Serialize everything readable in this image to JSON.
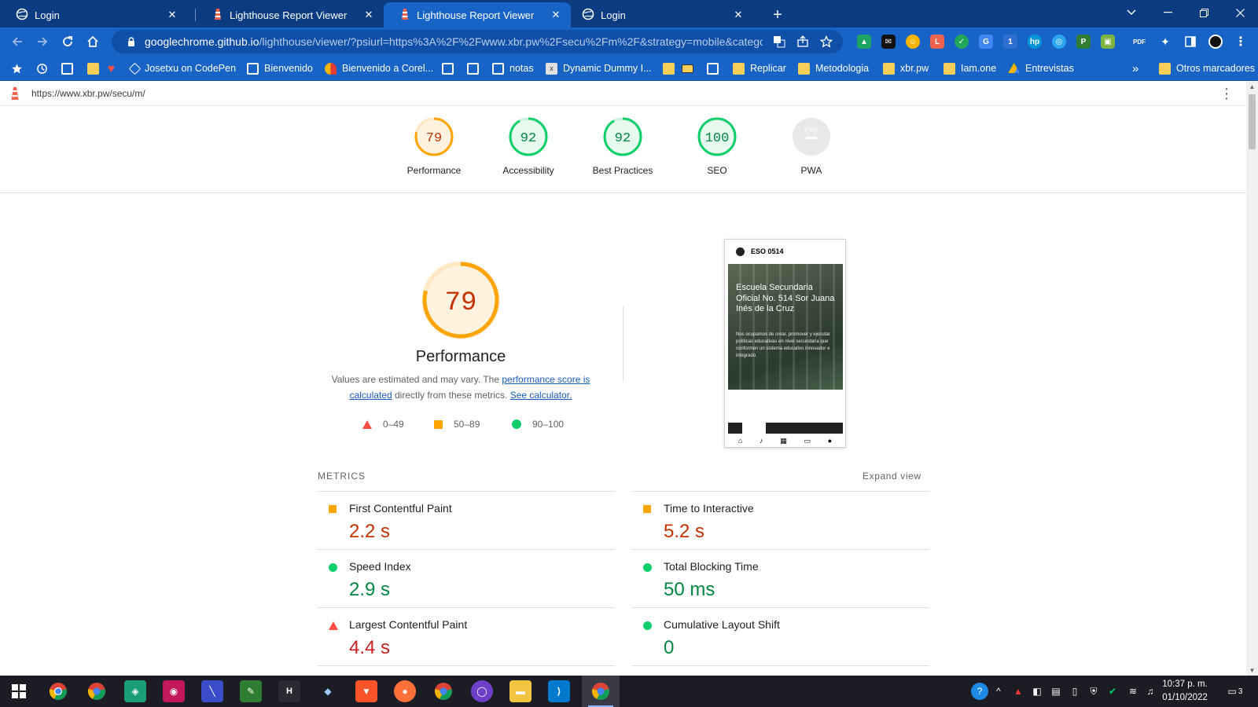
{
  "browser": {
    "tabs": [
      {
        "title": "Login",
        "icon": "globe-icon",
        "active": false
      },
      {
        "title": "Lighthouse Report Viewer",
        "icon": "lighthouse-icon",
        "active": false
      },
      {
        "title": "Lighthouse Report Viewer",
        "icon": "lighthouse-icon",
        "active": true
      },
      {
        "title": "Login",
        "icon": "globe-icon",
        "active": false
      }
    ],
    "close_glyph": "✕",
    "new_tab_glyph": "+",
    "omnibox": {
      "host": "googlechrome.github.io",
      "path": "/lighthouse/viewer/?psiurl=https%3A%2F%2Fwww.xbr.pw%2Fsecu%2Fm%2F&strategy=mobile&catego..."
    },
    "bookmarks": [
      {
        "label": "",
        "icon": "star-icon"
      },
      {
        "label": "",
        "icon": "history-icon"
      },
      {
        "label": "",
        "icon": "globe-icon"
      },
      {
        "label": "",
        "icon": "folder-icon"
      },
      {
        "label": "",
        "icon": "heart-icon"
      },
      {
        "label": "Josetxu on CodePen",
        "icon": "codepen-icon"
      },
      {
        "label": "Bienvenido",
        "icon": "globe-icon"
      },
      {
        "label": "Bienvenido a Corel...",
        "icon": "corel-icon"
      },
      {
        "label": "",
        "icon": "globe-icon"
      },
      {
        "label": "",
        "icon": "globe-icon"
      },
      {
        "label": "notas",
        "icon": "globe-icon"
      },
      {
        "label": "Dynamic Dummy I...",
        "icon": "dummy-icon"
      },
      {
        "label": "",
        "icon": "folder-icon"
      },
      {
        "label": "",
        "icon": "briefcase-icon"
      },
      {
        "label": "",
        "icon": "globe-icon"
      },
      {
        "label": "Replicar",
        "icon": "folder-icon"
      },
      {
        "label": "Metodologia",
        "icon": "folder-icon"
      },
      {
        "label": "xbr.pw",
        "icon": "folder-icon"
      },
      {
        "label": "Iam.one",
        "icon": "folder-icon"
      },
      {
        "label": "Entrevistas",
        "icon": "drive-icon"
      },
      {
        "label": "»",
        "icon": ""
      },
      {
        "label": "Otros marcadores",
        "icon": "folder-icon"
      }
    ]
  },
  "report": {
    "url": "https://www.xbr.pw/secu/m/",
    "categories": [
      {
        "label": "Performance",
        "score": "79",
        "status": "average"
      },
      {
        "label": "Accessibility",
        "score": "92",
        "status": "pass"
      },
      {
        "label": "Best Practices",
        "score": "92",
        "status": "pass"
      },
      {
        "label": "SEO",
        "score": "100",
        "status": "pass"
      },
      {
        "label": "PWA",
        "score": "PWA",
        "status": "na"
      }
    ],
    "performance": {
      "score": "79",
      "title": "Performance",
      "desc_prefix": "Values are estimated and may vary. The ",
      "desc_link1": "performance score is calculated",
      "desc_mid": " directly from these metrics. ",
      "desc_link2": "See calculator."
    },
    "legend": [
      {
        "range": "0–49",
        "status": "fail"
      },
      {
        "range": "50–89",
        "status": "average"
      },
      {
        "range": "90–100",
        "status": "pass"
      }
    ],
    "screenshot": {
      "site_name": "ESO 0514",
      "heading": "Escuela Secundaria Oficial No. 514 Sor Juana Inés de la Cruz",
      "body": "Nos ocupamos de crear, promover y ejecutar políticas educativas en nivel secundaria que conformen un sistema educativo innovador e integrado."
    },
    "metrics_header": "METRICS",
    "expand_label": "Expand view",
    "metrics": [
      {
        "label": "First Contentful Paint",
        "value": "2.2 s",
        "status": "average"
      },
      {
        "label": "Time to Interactive",
        "value": "5.2 s",
        "status": "average"
      },
      {
        "label": "Speed Index",
        "value": "2.9 s",
        "status": "pass"
      },
      {
        "label": "Total Blocking Time",
        "value": "50 ms",
        "status": "pass"
      },
      {
        "label": "Largest Contentful Paint",
        "value": "4.4 s",
        "status": "fail"
      },
      {
        "label": "Cumulative Layout Shift",
        "value": "0",
        "status": "pass"
      }
    ]
  },
  "taskbar": {
    "clock_time": "10:37 p. m.",
    "clock_date": "01/10/2022",
    "notification_count": "3"
  },
  "colors": {
    "pass": "#0cce6b",
    "average": "#ffa400",
    "fail": "#ff4e42",
    "chrome_frame": "#0b3c82",
    "chrome_toolbar": "#1763c6"
  }
}
